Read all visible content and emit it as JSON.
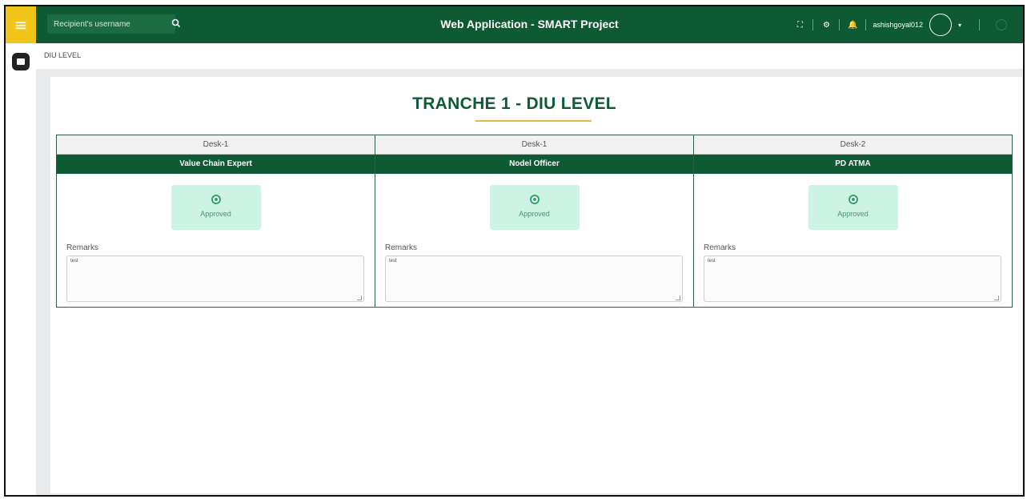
{
  "header": {
    "search_placeholder": "Recipient's username",
    "app_title": "Web Application - SMART Project",
    "username": "ashishgoyal012"
  },
  "breadcrumb": "DIU LEVEL",
  "page_title": "TRANCHE 1 - DIU LEVEL",
  "desks": [
    {
      "desk": "Desk-1",
      "role": "Value Chain Expert",
      "status": "Approved",
      "remarks_label": "Remarks",
      "remarks": "test"
    },
    {
      "desk": "Desk-1",
      "role": "Nodel Officer",
      "status": "Approved",
      "remarks_label": "Remarks",
      "remarks": "test"
    },
    {
      "desk": "Desk-2",
      "role": "PD ATMA",
      "status": "Approved",
      "remarks_label": "Remarks",
      "remarks": "test"
    }
  ],
  "colors": {
    "primary_green": "#0e5a34",
    "menu_yellow": "#f0c419",
    "approved_bg": "#ccf3e3",
    "title_underline": "#e1b44c"
  },
  "icons": {
    "menu": "hamburger-icon",
    "search": "search-icon",
    "fullscreen": "expand-icon",
    "settings": "gear-icon",
    "notifications": "bell-icon",
    "power": "power-icon",
    "side": "message-icon"
  }
}
